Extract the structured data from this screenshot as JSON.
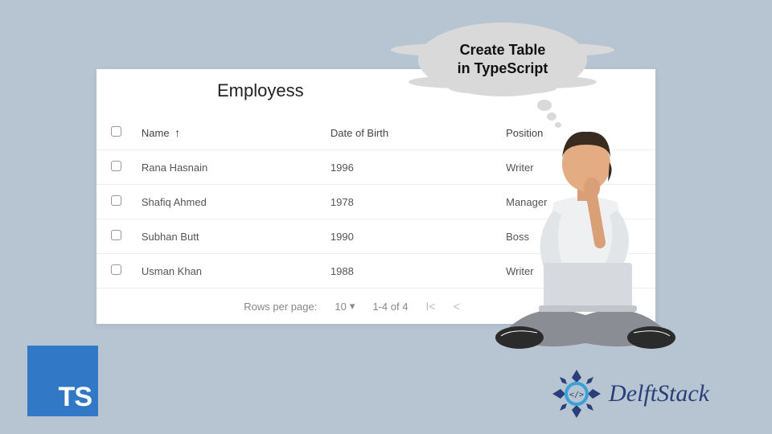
{
  "table": {
    "title": "Employess",
    "columns": {
      "name": "Name",
      "dob": "Date of Birth",
      "position": "Position"
    },
    "rows": [
      {
        "name": "Rana Hasnain",
        "dob": "1996",
        "position": "Writer"
      },
      {
        "name": "Shafiq Ahmed",
        "dob": "1978",
        "position": "Manager"
      },
      {
        "name": "Subhan Butt",
        "dob": "1990",
        "position": "Boss"
      },
      {
        "name": "Usman Khan",
        "dob": "1988",
        "position": "Writer"
      }
    ],
    "footer": {
      "rows_per_page_label": "Rows per page:",
      "rows_per_page_value": "10",
      "range": "1-4 of 4"
    }
  },
  "bubble": {
    "line1": "Create Table",
    "line2": "in TypeScript"
  },
  "logos": {
    "ts": "TS",
    "delft": "DelftStack"
  }
}
